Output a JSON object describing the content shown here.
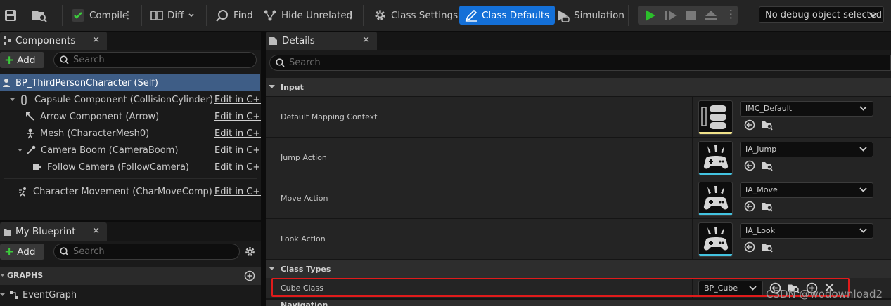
{
  "toolbar": {
    "compile": "Compile",
    "diff": "Diff",
    "find": "Find",
    "hide_unrelated": "Hide Unrelated",
    "class_settings": "Class Settings",
    "class_defaults": "Class Defaults",
    "simulation": "Simulation",
    "debug_object": "No debug object selected",
    "accent_color": "#1470d8",
    "play_color": "#2bbf2b"
  },
  "components": {
    "tab_label": "Components",
    "add_label": "Add",
    "search_placeholder": "Search",
    "root": "BP_ThirdPersonCharacter (Self)",
    "edit_label": "Edit in C++",
    "items": [
      {
        "label": "Capsule Component (CollisionCylinder)",
        "icon": "capsule-icon"
      },
      {
        "label": "Arrow Component (Arrow)",
        "icon": "arrow-icon"
      },
      {
        "label": "Mesh (CharacterMesh0)",
        "icon": "skeleton-icon"
      },
      {
        "label": "Camera Boom (CameraBoom)",
        "icon": "camera-boom-icon"
      },
      {
        "label": "Follow Camera (FollowCamera)",
        "icon": "camera-icon"
      },
      {
        "label": "Character Movement (CharMoveComp)",
        "icon": "movement-icon"
      }
    ]
  },
  "my_blueprint": {
    "tab_label": "My Blueprint",
    "add_label": "Add",
    "search_placeholder": "Search",
    "graphs_header": "GRAPHS",
    "event_graph": "EventGraph"
  },
  "details": {
    "tab_label": "Details",
    "search_placeholder": "Search",
    "input_section": "Input",
    "class_types_section": "Class Types",
    "navigation_section": "Navigation",
    "properties": [
      {
        "label": "Default Mapping Context",
        "value": "IMC_Default",
        "bar_color": "#f0e28a"
      },
      {
        "label": "Jump Action",
        "value": "IA_Jump",
        "bar_color": "#43c3e0"
      },
      {
        "label": "Move Action",
        "value": "IA_Move",
        "bar_color": "#43c3e0"
      },
      {
        "label": "Look Action",
        "value": "IA_Look",
        "bar_color": "#43c3e0"
      }
    ],
    "cube_class": {
      "label": "Cube Class",
      "value": "BP_Cube"
    },
    "highlight_color": "#e01b1b"
  },
  "watermark": "CSDN @wodownload2"
}
